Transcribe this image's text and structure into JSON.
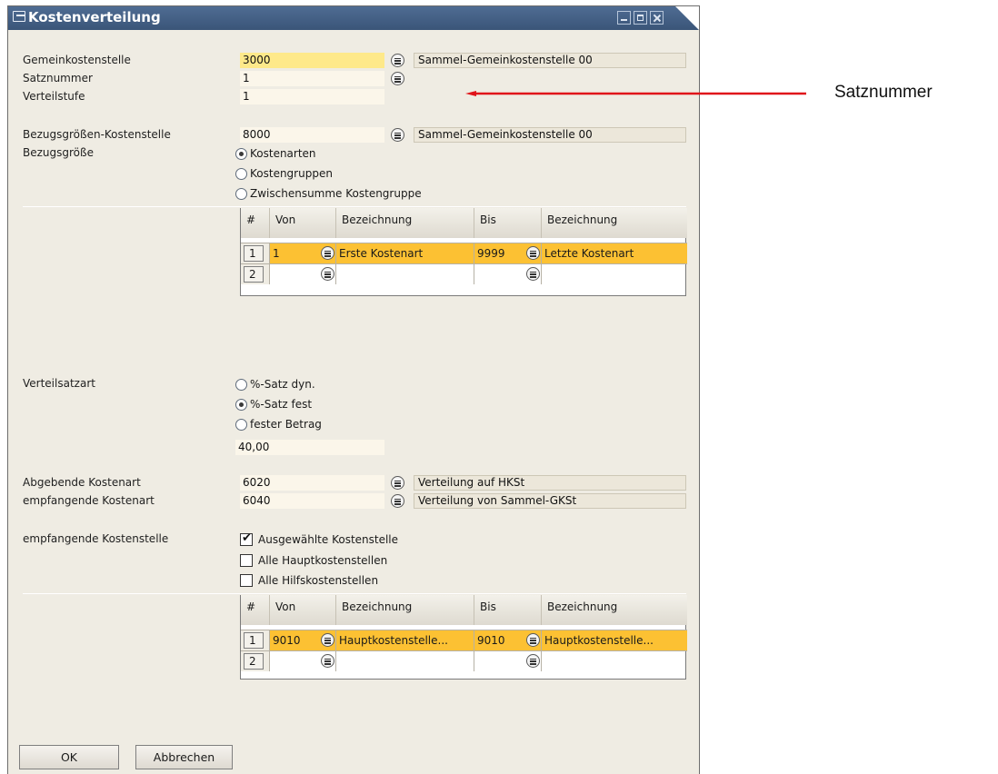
{
  "window": {
    "title": "Kostenverteilung"
  },
  "header_fields": {
    "gemeinkostenstelle": {
      "label": "Gemeinkostenstelle",
      "value": "3000",
      "description": "Sammel-Gemeinkostenstelle 00"
    },
    "satznummer": {
      "label": "Satznummer",
      "value": "1"
    },
    "verteilstufe": {
      "label": "Verteilstufe",
      "value": "1"
    }
  },
  "bezug": {
    "kostenstelle_label": "Bezugsgrößen-Kostenstelle",
    "kostenstelle_value": "8000",
    "kostenstelle_description": "Sammel-Gemeinkostenstelle 00",
    "groesse_label": "Bezugsgröße",
    "options": [
      {
        "label": "Kostenarten",
        "selected": true
      },
      {
        "label": "Kostengruppen",
        "selected": false
      },
      {
        "label": "Zwischensumme Kostengruppe",
        "selected": false
      }
    ]
  },
  "grid1": {
    "columns": [
      "#",
      "Von",
      "Bezeichnung",
      "Bis",
      "Bezeichnung"
    ],
    "rows": [
      {
        "num": "1",
        "von": "1",
        "von_bez": "Erste Kostenart",
        "bis": "9999",
        "bis_bez": "Letzte Kostenart"
      },
      {
        "num": "2",
        "von": "",
        "von_bez": "",
        "bis": "",
        "bis_bez": ""
      }
    ]
  },
  "verteilsatz": {
    "label": "Verteilsatzart",
    "options": [
      {
        "label": "%-Satz dyn.",
        "selected": false
      },
      {
        "label": "%-Satz fest",
        "selected": true
      },
      {
        "label": "fester Betrag",
        "selected": false
      }
    ],
    "value": "40,00"
  },
  "kostenarten": {
    "abgebende_label": "Abgebende Kostenart",
    "abgebende_value": "6020",
    "abgebende_description": "Verteilung auf HKSt",
    "empfangende_label": "empfangende Kostenart",
    "empfangende_value": "6040",
    "empfangende_description": "Verteilung von Sammel-GKSt"
  },
  "empfangende_kostenstelle": {
    "label": "empfangende Kostenstelle",
    "options": [
      {
        "label": "Ausgewählte Kostenstelle",
        "checked": true
      },
      {
        "label": "Alle Hauptkostenstellen",
        "checked": false
      },
      {
        "label": "Alle Hilfskostenstellen",
        "checked": false
      }
    ]
  },
  "grid2": {
    "columns": [
      "#",
      "Von",
      "Bezeichnung",
      "Bis",
      "Bezeichnung"
    ],
    "rows": [
      {
        "num": "1",
        "von": "9010",
        "von_bez": "Hauptkostenstelle...",
        "bis": "9010",
        "bis_bez": "Hauptkostenstelle..."
      },
      {
        "num": "2",
        "von": "",
        "von_bez": "",
        "bis": "",
        "bis_bez": ""
      }
    ]
  },
  "buttons": {
    "ok": "OK",
    "cancel": "Abbrechen"
  },
  "annotation": {
    "text": "Satznummer",
    "arrow_color": "#e0141a"
  }
}
